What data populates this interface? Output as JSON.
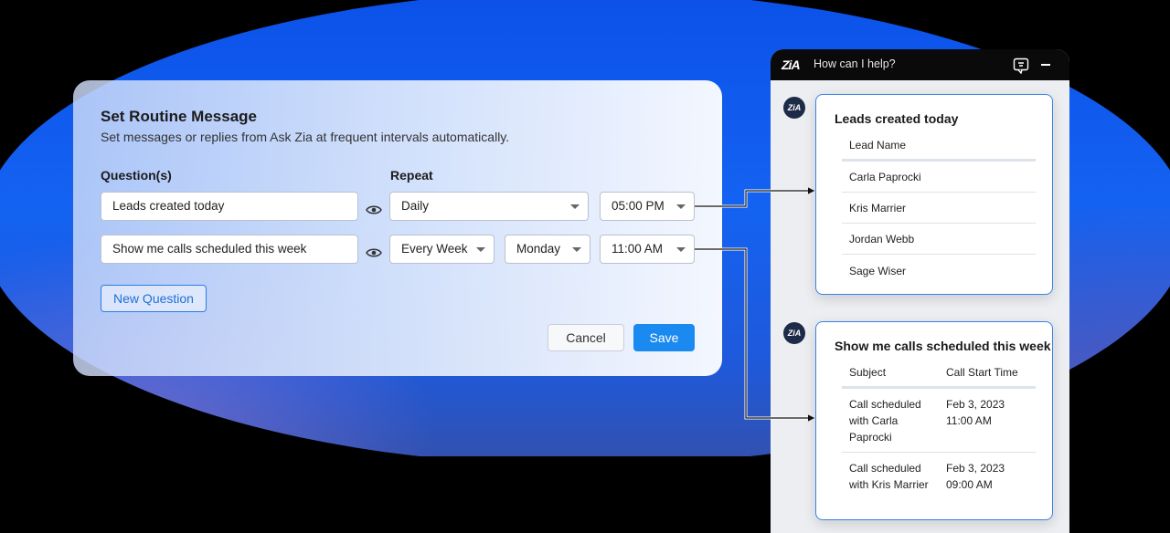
{
  "dialog": {
    "title": "Set Routine Message",
    "subtitle": "Set messages or replies from Ask Zia at frequent intervals automatically.",
    "questions_label": "Question(s)",
    "repeat_label": "Repeat",
    "rows": [
      {
        "question": "Leads created today",
        "repeat": "Daily",
        "time": "05:00 PM"
      },
      {
        "question": "Show me calls scheduled this week",
        "repeat": "Every Week",
        "day": "Monday",
        "time": "11:00 AM"
      }
    ],
    "new_question_label": "New Question",
    "cancel_label": "Cancel",
    "save_label": "Save"
  },
  "chat": {
    "logo": "ZiA",
    "prompt": "How can I help?",
    "avatar_text": "ZiA",
    "card1": {
      "title": "Leads created today",
      "column": "Lead Name",
      "rows": [
        "Carla Paprocki",
        "Kris Marrier",
        "Jordan Webb",
        "Sage Wiser"
      ]
    },
    "card2": {
      "title": "Show me calls scheduled this week",
      "columns": [
        "Subject",
        "Call Start Time"
      ],
      "rows": [
        {
          "subject_lines": [
            "Call scheduled",
            "with Carla",
            "Paprocki"
          ],
          "time_lines": [
            "Feb 3, 2023",
            "11:00 AM"
          ]
        },
        {
          "subject_lines": [
            "Call scheduled",
            "with Kris Marrier"
          ],
          "time_lines": [
            "Feb 3, 2023",
            "09:00 AM"
          ]
        }
      ]
    }
  },
  "colors": {
    "accent": "#1b8af0",
    "card_border": "#3b82e6",
    "background_blue": "#1462f2"
  },
  "icons": {
    "preview": "eye-icon",
    "dropdown": "chevron-down-icon",
    "chat_action": "chat-bubble-icon",
    "minimize": "minimize-icon"
  }
}
